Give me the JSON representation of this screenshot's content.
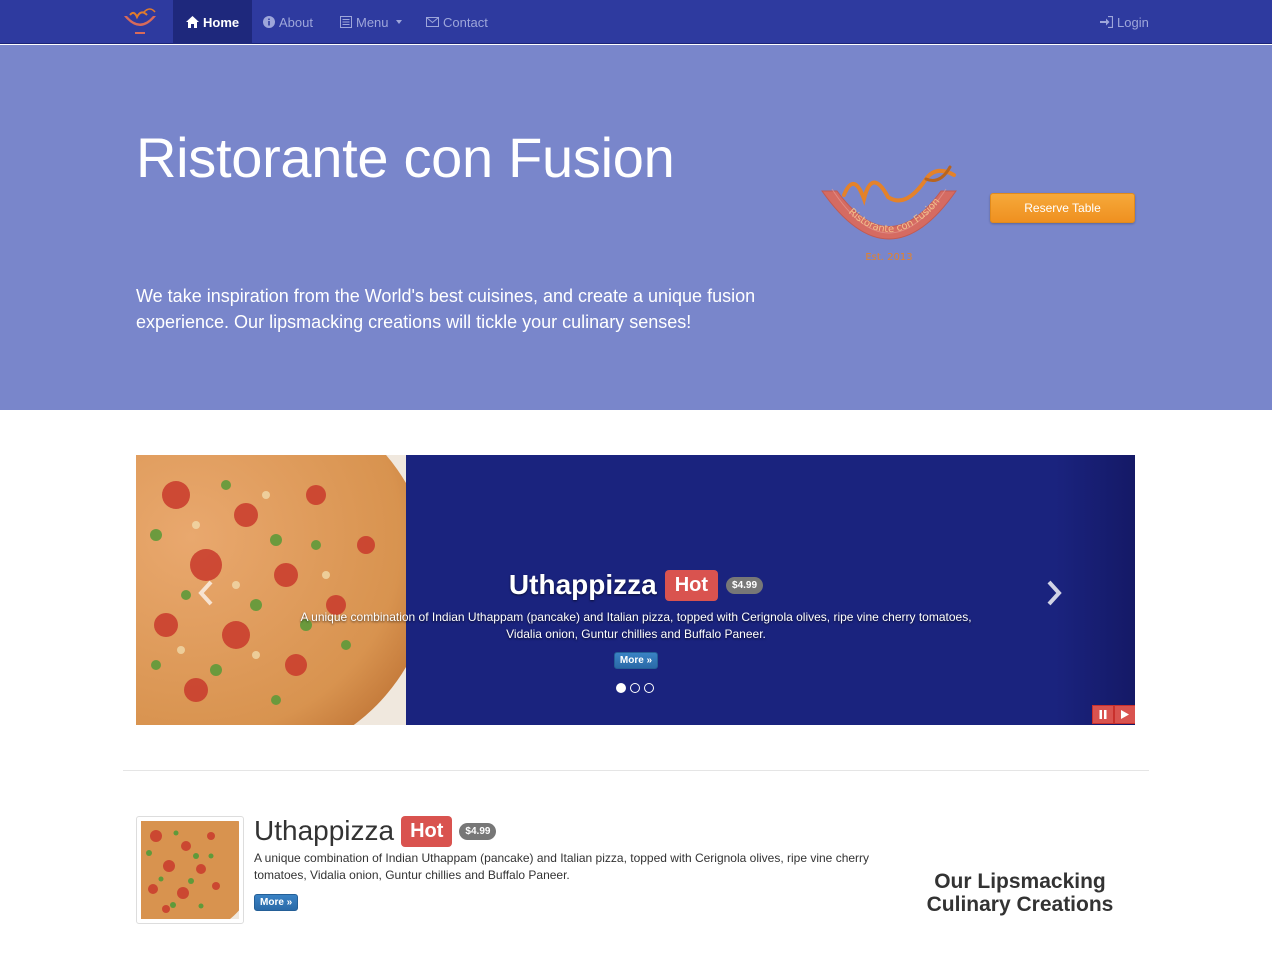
{
  "navbar": {
    "items": [
      {
        "label": "Home",
        "icon": "home-icon"
      },
      {
        "label": "About",
        "icon": "info-circle-icon"
      },
      {
        "label": "Menu",
        "icon": "list-icon"
      },
      {
        "label": "Contact",
        "icon": "envelope-icon"
      }
    ],
    "login": {
      "label": "Login",
      "icon": "sign-in-icon"
    }
  },
  "jumbotron": {
    "title": "Ristorante con Fusion",
    "text": "We take inspiration from the World's best cuisines, and create a unique fusion experience. Our lipsmacking creations will tickle your culinary senses!",
    "logo": {
      "text": "Ristorante con Fusion",
      "est": "Est. 2013"
    },
    "reserve_label": "Reserve Table"
  },
  "carousel": {
    "title": "Uthappizza",
    "badge": "Hot",
    "price": "$4.99",
    "description": "A unique combination of Indian Uthappam (pancake) and Italian pizza, topped with Cerignola olives, ripe vine cherry tomatoes, Vidalia onion, Guntur chillies and Buffalo Paneer.",
    "more_label": "More »",
    "slide_count": 3,
    "active_slide": 1
  },
  "featured": {
    "title": "Uthappizza",
    "badge": "Hot",
    "price": "$4.99",
    "description": "A unique combination of Indian Uthappam (pancake) and Italian pizza, topped with Cerignola olives, ripe vine cherry tomatoes, Vidalia onion, Guntur chillies and Buffalo Paneer.",
    "more_label": "More »"
  },
  "side_heading": "Our Lipsmacking Culinary Creations",
  "colors": {
    "navbar": "#2e3a9f",
    "jumbotron": "#7986cb",
    "carousel": "#1a237e",
    "reserve_button": "#f0a030",
    "hot_badge": "#d9534f"
  }
}
